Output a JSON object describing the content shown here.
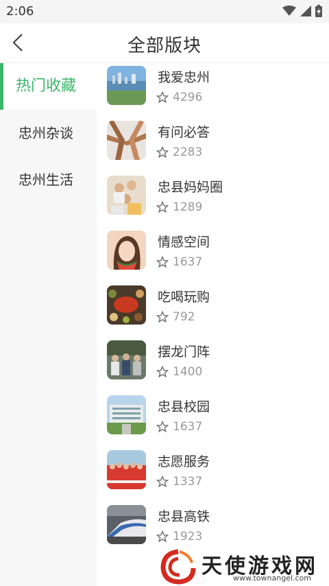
{
  "status_bar": {
    "time": "2:06"
  },
  "header": {
    "title": "全部版块"
  },
  "sidebar": {
    "items": [
      {
        "label": "热门收藏",
        "active": true
      },
      {
        "label": "忠州杂谈",
        "active": false
      },
      {
        "label": "忠州生活",
        "active": false
      }
    ]
  },
  "forums": [
    {
      "title": "我爱忠州",
      "count": "4296"
    },
    {
      "title": "有问必答",
      "count": "2283"
    },
    {
      "title": "忠县妈妈圈",
      "count": "1289"
    },
    {
      "title": "情感空间",
      "count": "1637"
    },
    {
      "title": "吃喝玩购",
      "count": "792"
    },
    {
      "title": "摆龙门阵",
      "count": "1400"
    },
    {
      "title": "忠县校园",
      "count": "1637"
    },
    {
      "title": "志愿服务",
      "count": "1337"
    },
    {
      "title": "忠县高铁",
      "count": "1923"
    }
  ],
  "watermark": {
    "name": "天使游戏网",
    "url": "www.townangel.com"
  },
  "colors": {
    "accent": "#3bb56a",
    "text": "#333333",
    "muted": "#999999",
    "sidebar_bg": "#f7f7f7"
  }
}
